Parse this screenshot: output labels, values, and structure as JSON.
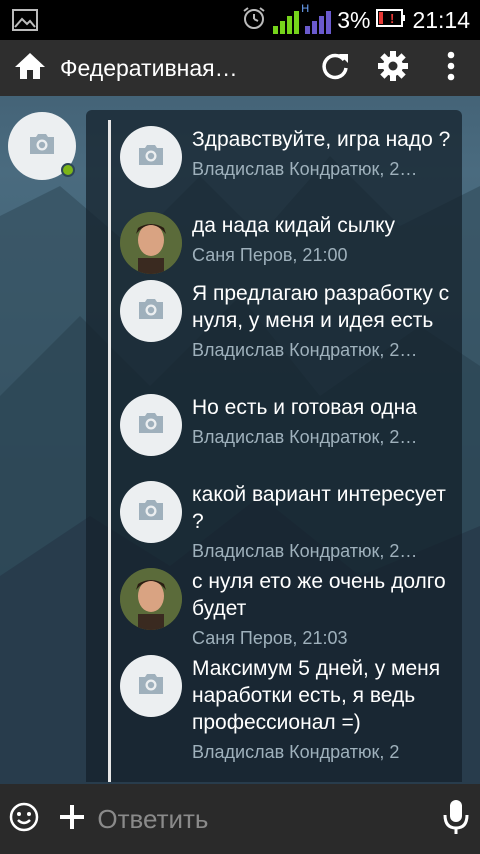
{
  "status_bar": {
    "battery_percent": "3%",
    "time": "21:14",
    "network_type": "H",
    "icons": [
      "gallery-icon",
      "alarm-icon",
      "signal-icon",
      "battery-alert-icon"
    ]
  },
  "app_bar": {
    "title": "Федеративная…",
    "icons": [
      "home-icon",
      "refresh-icon",
      "settings-icon",
      "more-vert-icon"
    ]
  },
  "messages": [
    {
      "text": "Здравствуйте, игра надо ?",
      "author": "Владислав Кондратюк, 2…",
      "avatar": "camera-placeholder"
    },
    {
      "text": "да нада кидай сылку",
      "author": "Саня Перов, 21:00",
      "avatar": "photo"
    },
    {
      "text": "Я предлагаю разработку с нуля, у меня и идея есть",
      "author": "Владислав Кондратюк, 2…",
      "avatar": "camera-placeholder"
    },
    {
      "text": "Но есть и готовая одна",
      "author": "Владислав Кондратюк, 2…",
      "avatar": "camera-placeholder"
    },
    {
      "text": "какой вариант интересует ?",
      "author": "Владислав Кондратюк, 2…",
      "avatar": "camera-placeholder"
    },
    {
      "text": "с нуля ето же очень долго будет",
      "author": "Саня Перов, 21:03",
      "avatar": "photo"
    },
    {
      "text": "Максимум 5 дней, у меня наработки есть, я ведь профессионал =)",
      "author": "Владислав Кондратюк, 2",
      "avatar": "camera-placeholder"
    }
  ],
  "composer": {
    "placeholder": "Ответить",
    "icons": [
      "emoji-icon",
      "plus-icon",
      "mic-icon"
    ]
  },
  "colors": {
    "status_bar_bg": "#000000",
    "app_bar_bg": "#2e2e2e",
    "composer_bg": "#2a2a2a",
    "online_indicator": "#7cb518",
    "signal_green": "#76d41b",
    "battery_alert": "#e53935",
    "meta_text": "#9fb1bc"
  }
}
